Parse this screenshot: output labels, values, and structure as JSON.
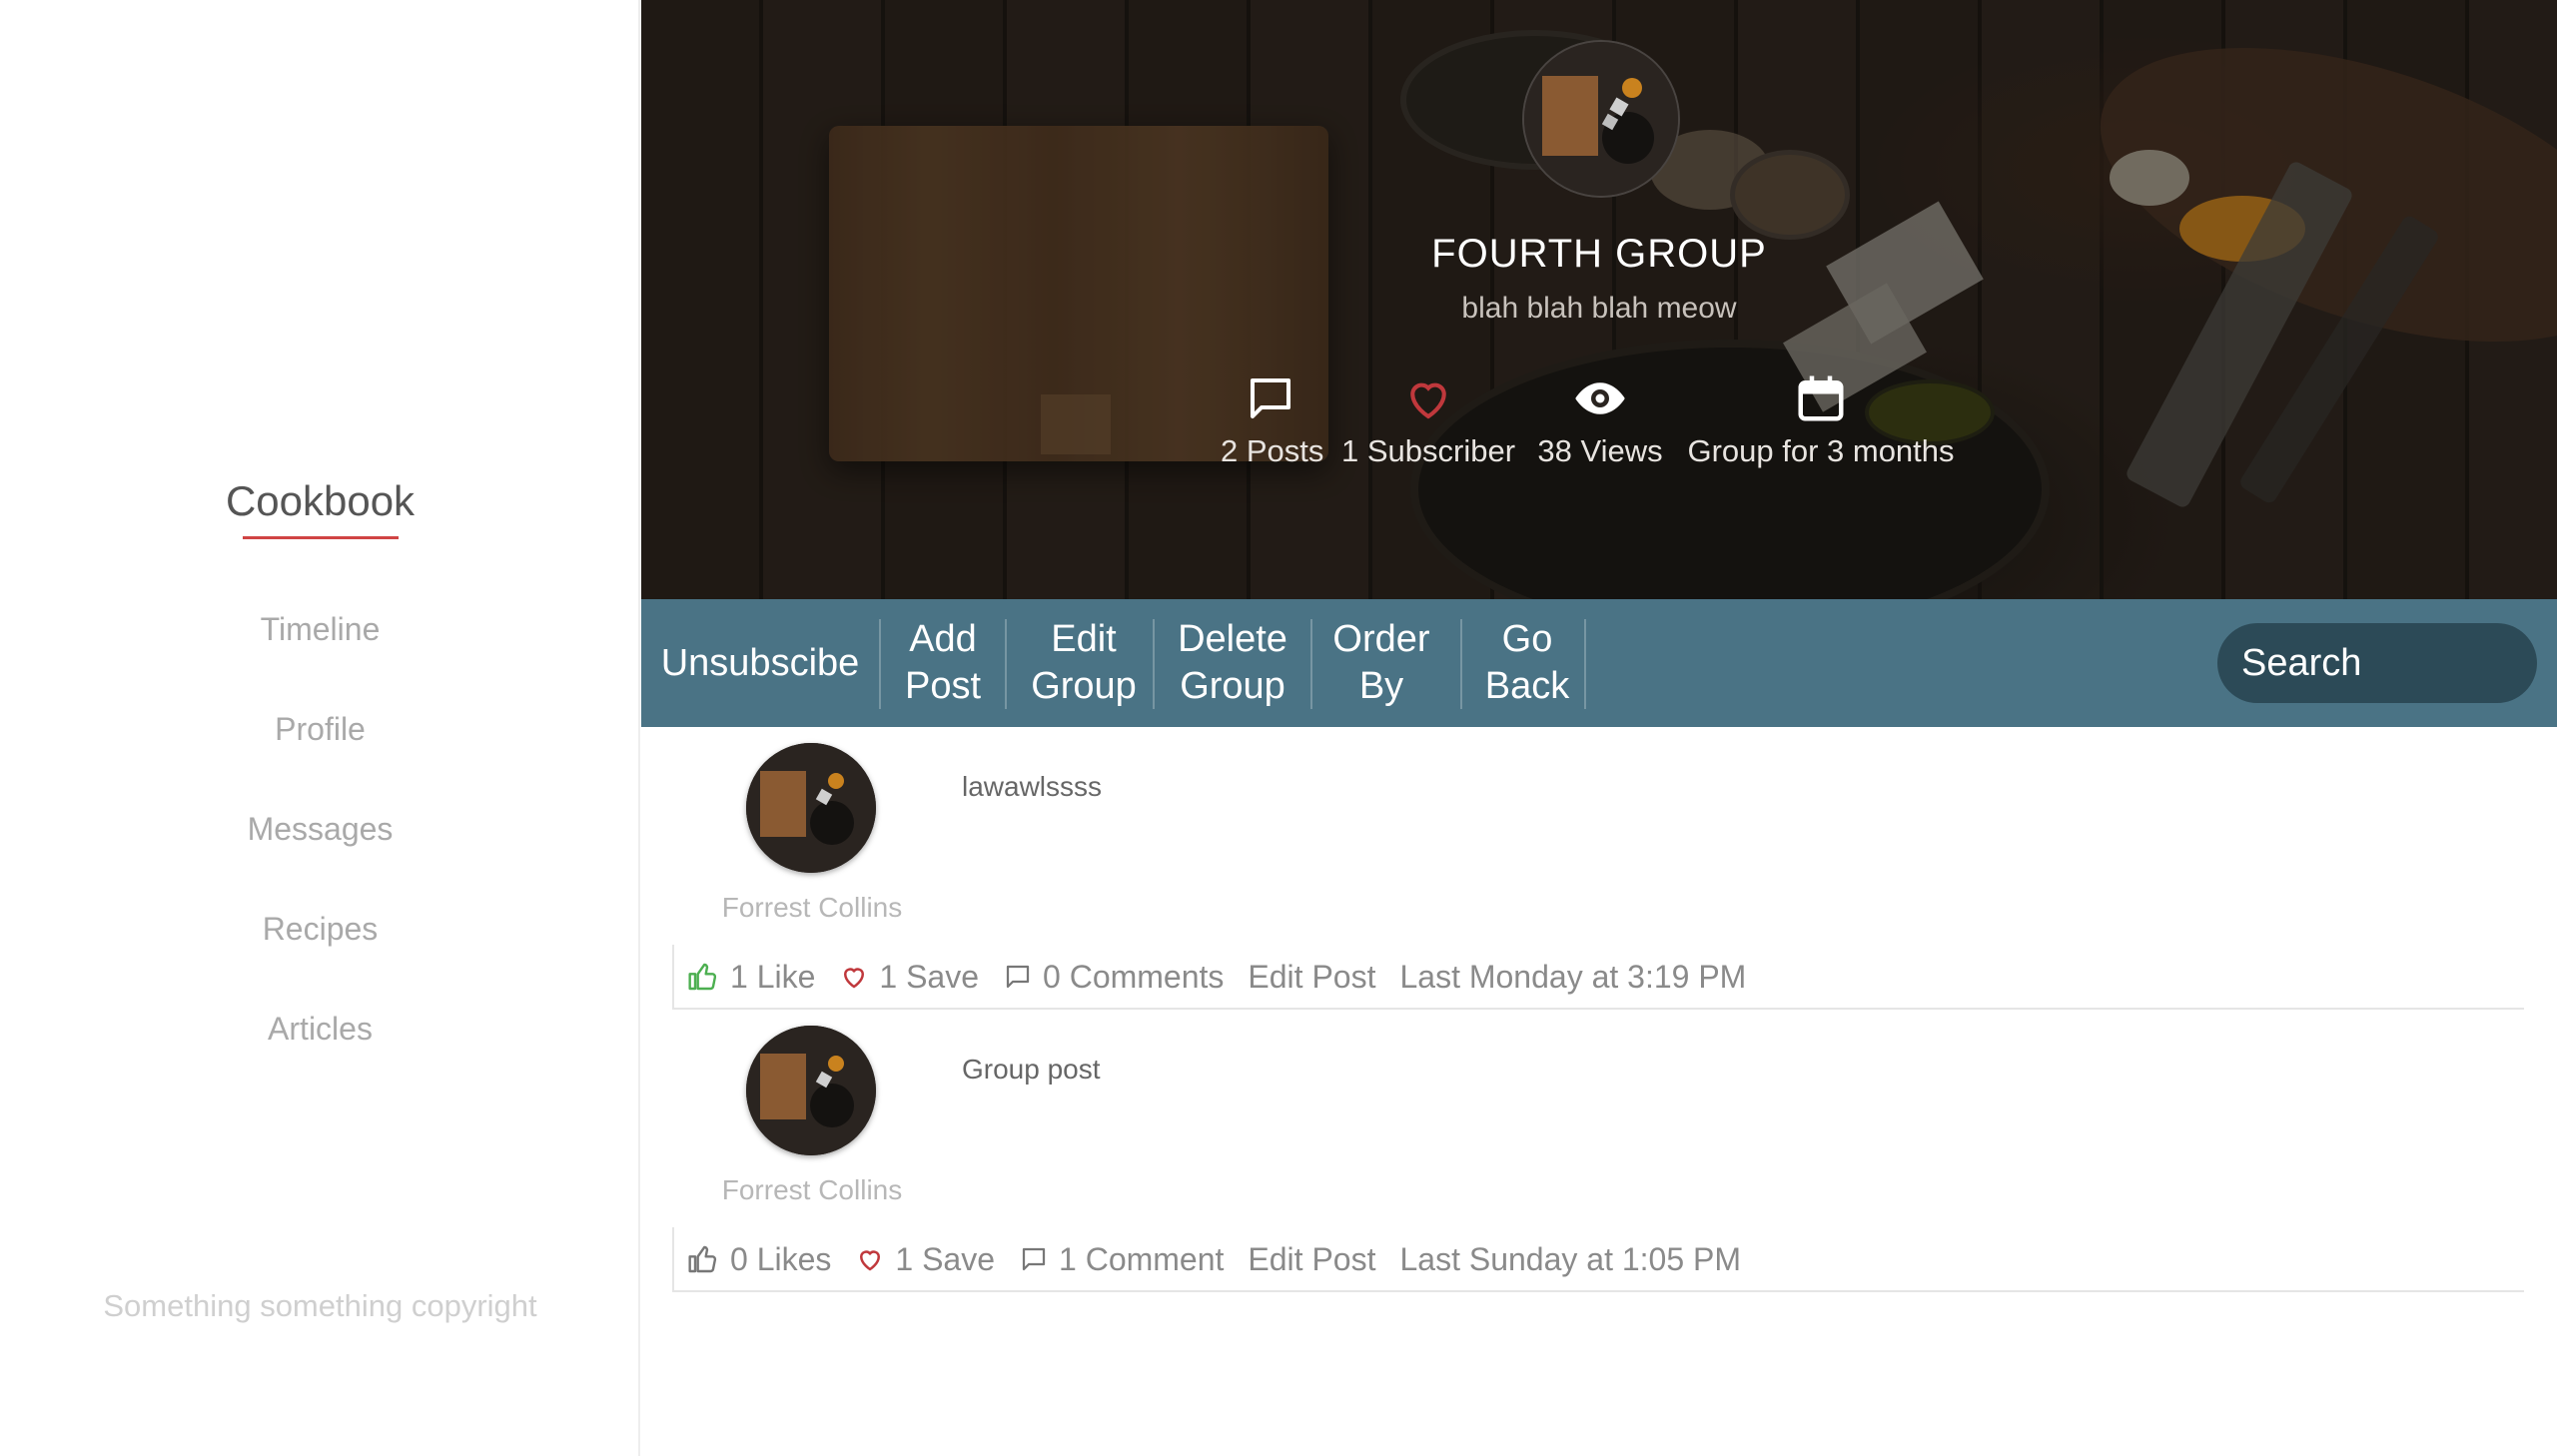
{
  "sidebar": {
    "brand": "Cookbook",
    "nav": [
      "Timeline",
      "Profile",
      "Messages",
      "Recipes",
      "Articles"
    ],
    "copyright": "Something something copyright"
  },
  "group": {
    "title": "FOURTH GROUP",
    "description": "blah blah blah meow",
    "stats": {
      "posts": "2 Posts",
      "subscribers": "1 Subscriber",
      "views": "38 Views",
      "age": "Group for 3 months"
    }
  },
  "toolbar": {
    "unsubscribe": "Unsubscibe",
    "add_post": [
      "Add",
      "Post"
    ],
    "edit_group": [
      "Edit",
      "Group"
    ],
    "delete_group": [
      "Delete",
      "Group"
    ],
    "order_by": [
      "Order",
      "By"
    ],
    "go_back": [
      "Go",
      "Back"
    ],
    "search_placeholder": "Search"
  },
  "posts": [
    {
      "author": "Forrest Collins",
      "text": "lawawlssss",
      "likes": "1 Like",
      "liked": true,
      "saves": "1 Save",
      "comments": "0 Comments",
      "edit": "Edit Post",
      "timestamp": "Last Monday at 3:19 PM"
    },
    {
      "author": "Forrest Collins",
      "text": "Group post",
      "likes": "0 Likes",
      "liked": false,
      "saves": "1 Save",
      "comments": "1 Comment",
      "edit": "Edit Post",
      "timestamp": "Last Sunday at 1:05 PM"
    }
  ],
  "icons": {
    "posts": "comment-icon",
    "subscribers": "heart-icon",
    "views": "eye-icon",
    "age": "calendar-icon",
    "like": "thumbs-up-icon",
    "save": "heart-icon",
    "comment": "comment-icon"
  },
  "colors": {
    "toolbar": "#4a7385",
    "search": "#2c4a57",
    "brand_underline": "#d04444",
    "heart": "#c0383c",
    "like_active": "#4caf50"
  }
}
